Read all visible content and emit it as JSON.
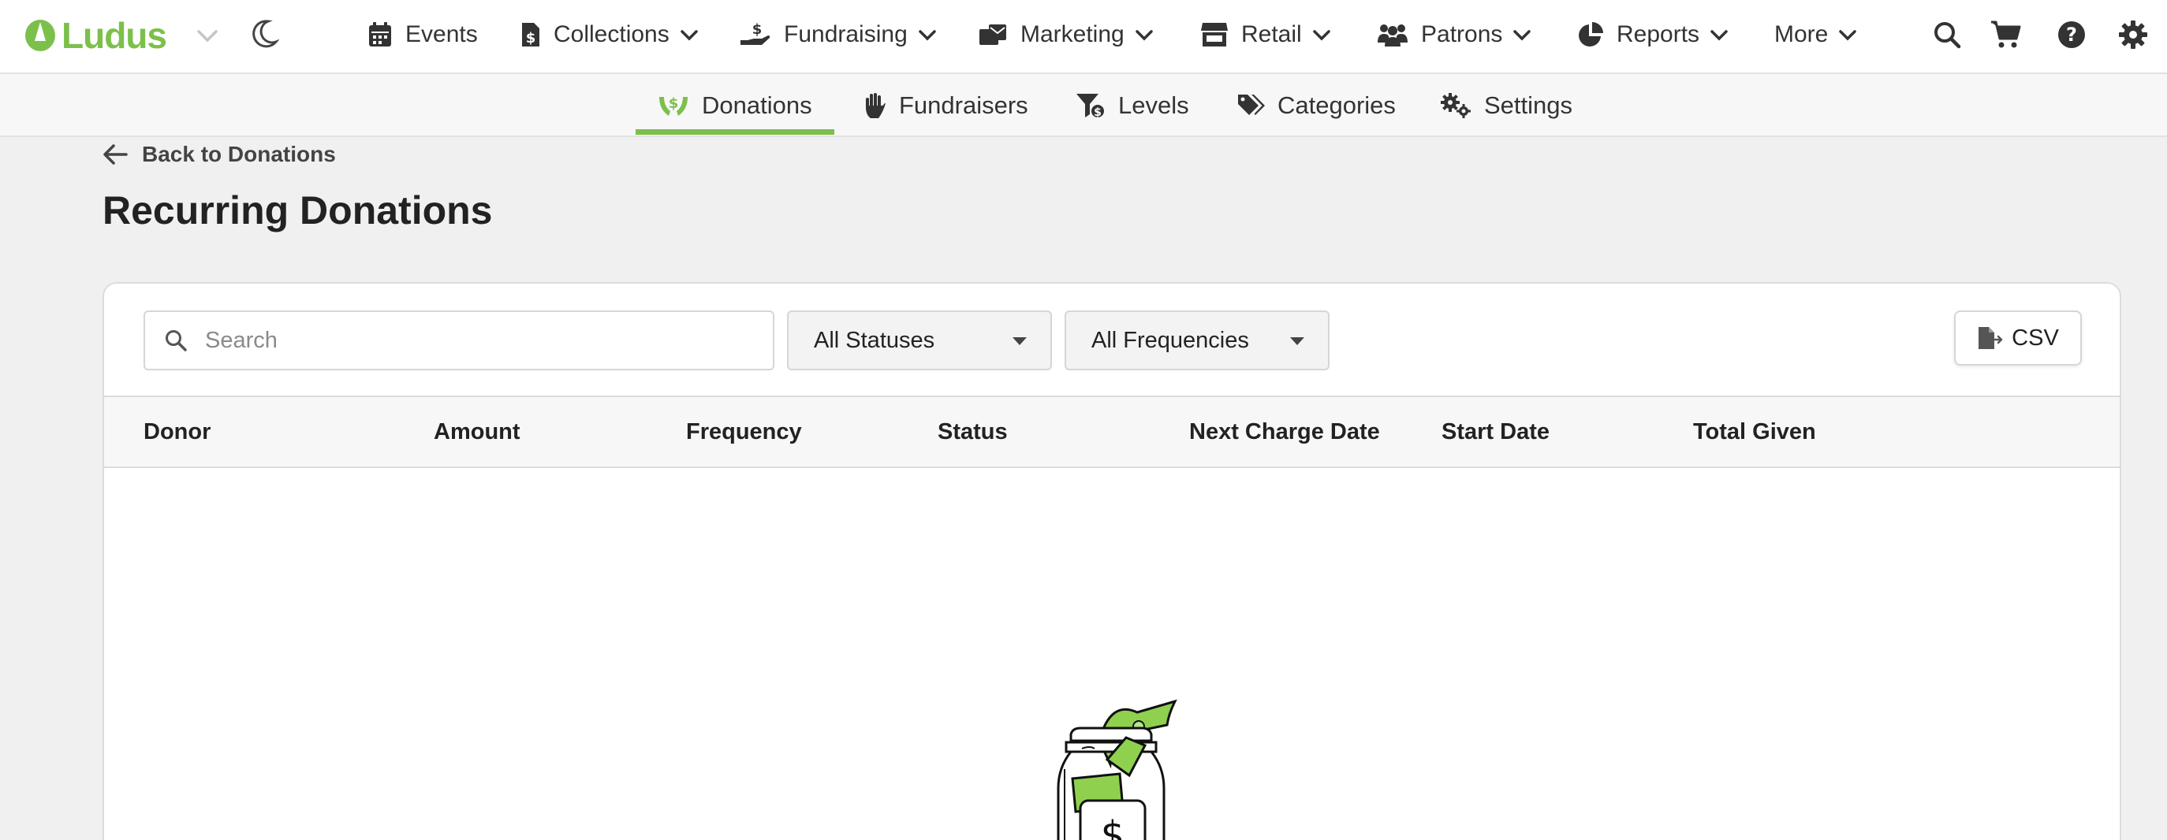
{
  "app": {
    "brand": "Ludus",
    "brand_color": "#7cc04b"
  },
  "topnav": {
    "items": [
      {
        "label": "Events",
        "icon": "calendar-icon"
      },
      {
        "label": "Collections",
        "icon": "file-dollar-icon"
      },
      {
        "label": "Fundraising",
        "icon": "hand-holding-dollar-icon"
      },
      {
        "label": "Marketing",
        "icon": "mailbox-icon"
      },
      {
        "label": "Retail",
        "icon": "store-icon"
      },
      {
        "label": "Patrons",
        "icon": "users-icon"
      },
      {
        "label": "Reports",
        "icon": "pie-chart-icon"
      },
      {
        "label": "More",
        "icon": ""
      }
    ],
    "utilities": [
      "search-icon",
      "cart-icon",
      "help-icon",
      "gear-icon"
    ]
  },
  "subnav": {
    "items": [
      {
        "label": "Donations",
        "icon": "hands-holding-dollar-icon",
        "active": true
      },
      {
        "label": "Fundraisers",
        "icon": "raised-hand-icon",
        "active": false
      },
      {
        "label": "Levels",
        "icon": "filter-dollar-icon",
        "active": false
      },
      {
        "label": "Categories",
        "icon": "tags-icon",
        "active": false
      },
      {
        "label": "Settings",
        "icon": "gears-icon",
        "active": false
      }
    ]
  },
  "page": {
    "back_label": "Back to Donations",
    "title": "Recurring Donations"
  },
  "toolbar": {
    "search_placeholder": "Search",
    "status_filter": "All Statuses",
    "frequency_filter": "All Frequencies",
    "csv_label": "CSV"
  },
  "table": {
    "columns": [
      "Donor",
      "Amount",
      "Frequency",
      "Status",
      "Next Charge Date",
      "Start Date",
      "Total Given"
    ],
    "rows": []
  },
  "empty_state": {
    "icon": "donation-jar-icon",
    "symbol": "$"
  }
}
